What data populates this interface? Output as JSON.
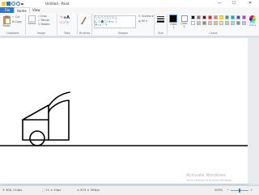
{
  "window": {
    "title": "Untitled - Paint",
    "minimize": "—",
    "maximize": "☐",
    "close": "✕"
  },
  "tabs": [
    "File",
    "Home",
    "View"
  ],
  "groups": {
    "clipboard": {
      "label": "Clipboard",
      "paste": "Paste",
      "cut": "Cut",
      "copy": "Copy"
    },
    "image": {
      "label": "Image",
      "select": "Select",
      "crop": "Crop",
      "resize": "Resize",
      "rotate": "Rotate"
    },
    "tools": {
      "label": "Tools"
    },
    "brushes": {
      "label": "Brushes"
    },
    "shapes": {
      "label": "Shapes",
      "outline": "Outline",
      "fill": "Fill"
    },
    "size": {
      "label": "Size"
    },
    "colors": {
      "label": "Colors",
      "color1": "Color 1",
      "color2": "Color 2",
      "edit": "Edit colors",
      "palette": [
        "#000000",
        "#7f7f7f",
        "#880015",
        "#ed1c24",
        "#ff7f27",
        "#fff200",
        "#22b14c",
        "#00a2e8",
        "#3f48cc",
        "#a349a4",
        "#ffffff",
        "#c3c3c3",
        "#b97a57",
        "#ffaec9",
        "#ffc90e",
        "#efe4b0",
        "#b5e61d",
        "#99d9ea",
        "#7092be",
        "#c8bfe7"
      ]
    }
  },
  "status": {
    "cursor": "306, 214px",
    "selection": "21 × 10px",
    "canvas_size": "873 × 394px",
    "zoom": "100%"
  },
  "watermark": {
    "title": "Activate Windows",
    "subtitle": "Go to Settings to activate Windows."
  }
}
